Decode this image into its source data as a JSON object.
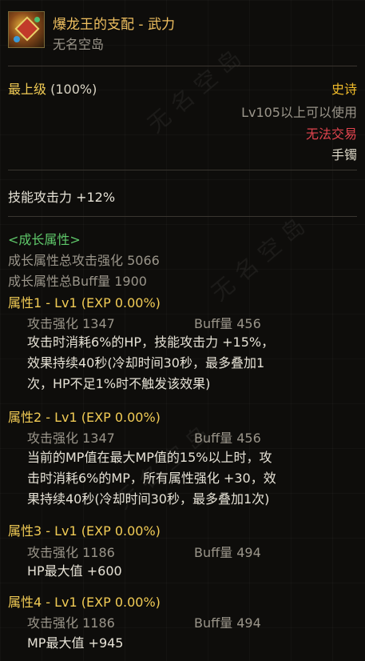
{
  "item": {
    "name": "爆龙王的支配 - 武力",
    "source": "无名空岛",
    "grade_label": "最上级",
    "grade_percent": "(100%)",
    "rarity": "史诗",
    "level_req": "Lv105以上可以使用",
    "trade": "无法交易",
    "slot": "手镯"
  },
  "stats": {
    "skill_attack": "技能攻击力  +12%"
  },
  "growth": {
    "header": "<成长属性>",
    "total_attack": "成长属性总攻击强化 5066",
    "total_buff": "成长属性总Buff量 1900",
    "attributes": [
      {
        "title": "属性1 - Lv1 (EXP 0.00%)",
        "attack": "攻击强化  1347",
        "buff": "Buff量  456",
        "desc": [
          "攻击时消耗6%的HP，技能攻击力 +15%，",
          "效果持续40秒(冷却时间30秒，最多叠加1",
          "次，HP不足1%时不触发该效果)"
        ]
      },
      {
        "title": "属性2 - Lv1 (EXP 0.00%)",
        "attack": "攻击强化  1347",
        "buff": "Buff量  456",
        "desc": [
          "当前的MP值在最大MP值的15%以上时，攻",
          "击时消耗6%的MP，所有属性强化 +30，效",
          "果持续40秒(冷却时间30秒，最多叠加1次)"
        ]
      },
      {
        "title": "属性3 - Lv1 (EXP 0.00%)",
        "attack": "攻击强化  1186",
        "buff": "Buff量  494",
        "desc": [
          "HP最大值 +600"
        ]
      },
      {
        "title": "属性4 - Lv1 (EXP 0.00%)",
        "attack": "攻击强化  1186",
        "buff": "Buff量  494",
        "desc": [
          "MP最大值 +945"
        ]
      }
    ]
  },
  "colors": {
    "title": "#f0c060",
    "epic": "#f0bb2a",
    "untradable": "#e0444e",
    "growth_header": "#5fc86a",
    "property": "#f2cc55"
  }
}
